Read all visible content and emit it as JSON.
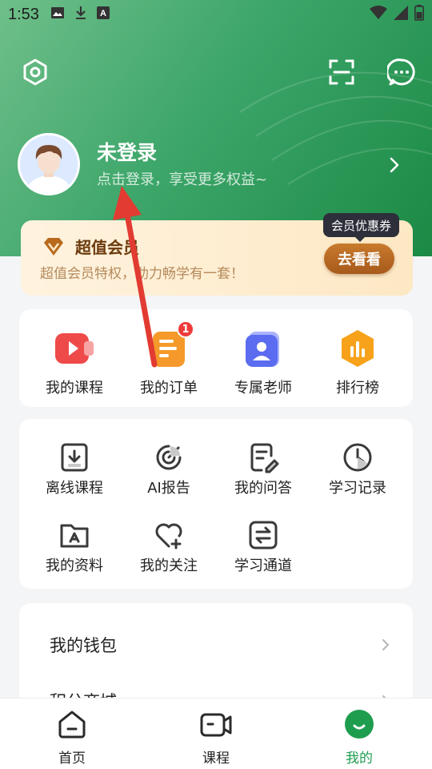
{
  "status_bar": {
    "time": "1:53"
  },
  "profile": {
    "name": "未登录",
    "subtitle": "点击登录，享受更多权益~"
  },
  "vip": {
    "title": "超值会员",
    "subtitle": "超值会员特权，助力畅学有一套！",
    "button_label": "去看看",
    "coupon_tag": "会员优惠券"
  },
  "quick_actions": [
    {
      "label": "我的课程",
      "icon": "video-icon",
      "color": "#ef4a4a"
    },
    {
      "label": "我的订单",
      "icon": "order-icon",
      "color": "#f59a2a",
      "badge": "1"
    },
    {
      "label": "专属老师",
      "icon": "teacher-icon",
      "color": "#5b6cf0"
    },
    {
      "label": "排行榜",
      "icon": "ranking-icon",
      "color": "#f7a21a"
    }
  ],
  "tools": [
    {
      "label": "离线课程",
      "icon": "download-icon"
    },
    {
      "label": "AI报告",
      "icon": "ai-report-icon"
    },
    {
      "label": "我的问答",
      "icon": "qa-icon"
    },
    {
      "label": "学习记录",
      "icon": "clock-icon"
    },
    {
      "label": "我的资料",
      "icon": "folder-icon"
    },
    {
      "label": "我的关注",
      "icon": "heart-plus-icon"
    },
    {
      "label": "学习通道",
      "icon": "exchange-icon"
    }
  ],
  "list": [
    {
      "label": "我的钱包"
    },
    {
      "label": "积分商城"
    }
  ],
  "bottom_nav": [
    {
      "label": "首页",
      "icon": "home-icon"
    },
    {
      "label": "课程",
      "icon": "course-video-icon"
    },
    {
      "label": "我的",
      "icon": "profile-smile-icon",
      "active": true
    }
  ],
  "colors": {
    "brand_green": "#1f9d4f",
    "header_gradient": [
      "#6fbf8a",
      "#1b8a45"
    ],
    "vip_button": "#b4661f",
    "badge_red": "#ef3b3b",
    "annotation_arrow": "#e23b32"
  }
}
